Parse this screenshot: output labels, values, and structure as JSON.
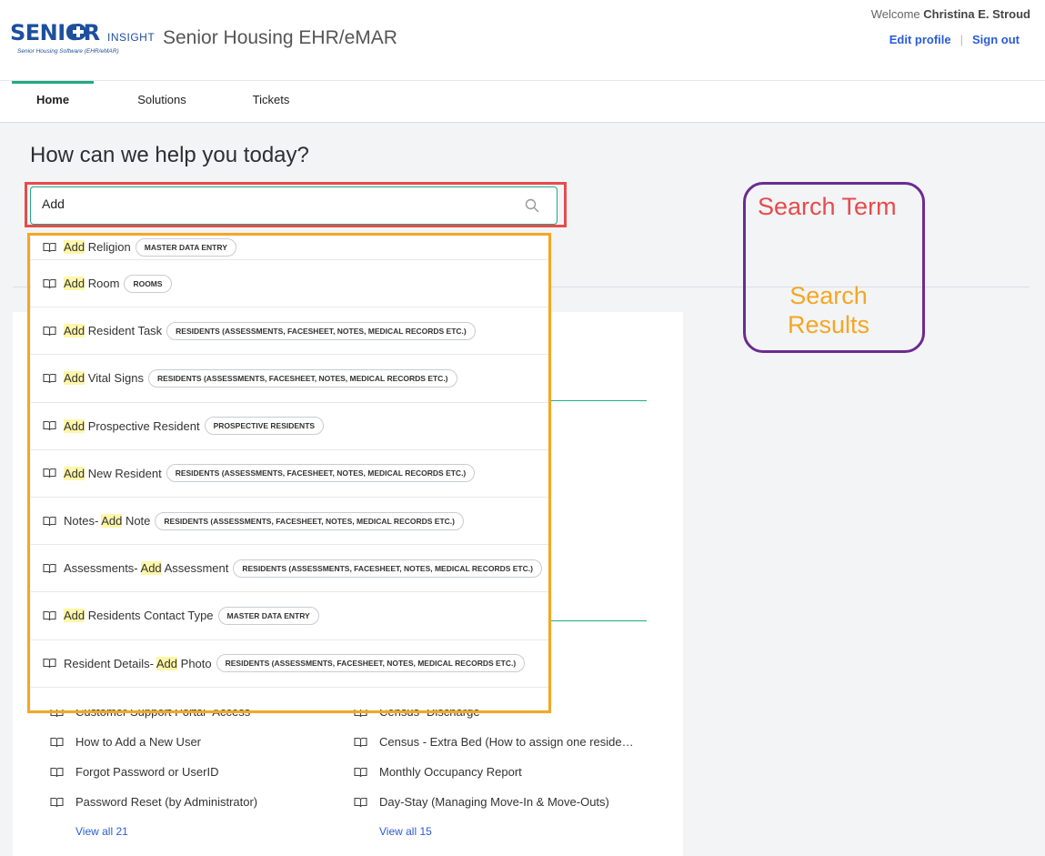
{
  "brand": {
    "logo_word": "SENIOR",
    "logo_word2": "INSIGHT",
    "logo_tagline": "Senior Housing Software (EHR/eMAR)",
    "app_title": "Senior Housing EHR/eMAR"
  },
  "user": {
    "welcome_prefix": "Welcome",
    "name": "Christina E. Stroud",
    "edit_profile": "Edit profile",
    "sign_out": "Sign out"
  },
  "nav": {
    "tabs": [
      {
        "label": "Home",
        "active": true
      },
      {
        "label": "Solutions",
        "active": false
      },
      {
        "label": "Tickets",
        "active": false
      }
    ]
  },
  "hero": {
    "title": "How can we help you today?",
    "search_value": "Add"
  },
  "results": [
    {
      "pre": "",
      "match": "Add",
      "post": " Religion",
      "category": "MASTER DATA ENTRY"
    },
    {
      "pre": "",
      "match": "Add",
      "post": " Room",
      "category": "ROOMS"
    },
    {
      "pre": "",
      "match": "Add",
      "post": " Resident Task",
      "category": "RESIDENTS (ASSESSMENTS, FACESHEET, NOTES, MEDICAL RECORDS ETC.)"
    },
    {
      "pre": "",
      "match": "Add",
      "post": " Vital Signs",
      "category": "RESIDENTS (ASSESSMENTS, FACESHEET, NOTES, MEDICAL RECORDS ETC.)"
    },
    {
      "pre": "",
      "match": "Add",
      "post": " Prospective Resident",
      "category": "PROSPECTIVE RESIDENTS"
    },
    {
      "pre": "",
      "match": "Add",
      "post": " New Resident",
      "category": "RESIDENTS (ASSESSMENTS, FACESHEET, NOTES, MEDICAL RECORDS ETC.)"
    },
    {
      "pre": "Notes- ",
      "match": "Add",
      "post": " Note",
      "category": "RESIDENTS (ASSESSMENTS, FACESHEET, NOTES, MEDICAL RECORDS ETC.)"
    },
    {
      "pre": "Assessments- ",
      "match": "Add",
      "post": " Assessment",
      "category": "RESIDENTS (ASSESSMENTS, FACESHEET, NOTES, MEDICAL RECORDS ETC.)"
    },
    {
      "pre": "",
      "match": "Add",
      "post": " Residents Contact Type",
      "category": "MASTER DATA ENTRY"
    },
    {
      "pre": "Resident Details- ",
      "match": "Add",
      "post": " Photo",
      "category": "RESIDENTS (ASSESSMENTS, FACESHEET, NOTES, MEDICAL RECORDS ETC.)"
    }
  ],
  "annotations": {
    "search_term": "Search Term",
    "search_results": "Search Results"
  },
  "articles": {
    "left": [
      "Customer Support Portal- Access",
      "How to Add a New User",
      "Forgot Password or UserID",
      "Password Reset (by Administrator)"
    ],
    "left_view_all": "View all 21",
    "right": [
      "Census- Discharge",
      "Census - Extra Bed (How to assign one reside…",
      "Monthly Occupancy Report",
      "Day-Stay (Managing Move-In & Move-Outs)"
    ],
    "right_view_all": "View all 15"
  },
  "colors": {
    "brand_blue": "#1d4f9c",
    "accent_green": "#22a884",
    "link_blue": "#2a5bd7",
    "annot_red": "#e84b4b",
    "annot_orange": "#f5a623",
    "annot_purple": "#6a2c91",
    "highlight_yellow": "#fff6a8"
  }
}
